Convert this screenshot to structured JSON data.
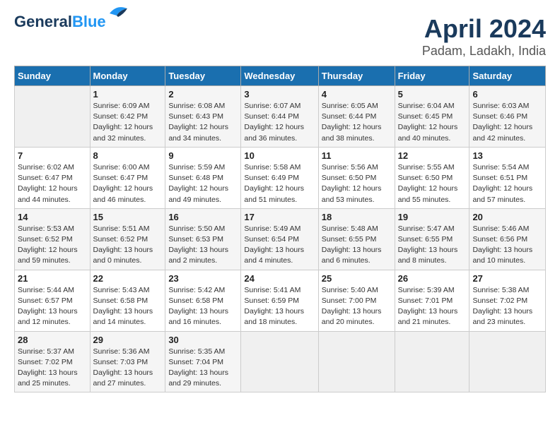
{
  "header": {
    "logo_line1": "General",
    "logo_line2": "Blue",
    "title": "April 2024",
    "subtitle": "Padam, Ladakh, India"
  },
  "weekdays": [
    "Sunday",
    "Monday",
    "Tuesday",
    "Wednesday",
    "Thursday",
    "Friday",
    "Saturday"
  ],
  "weeks": [
    [
      {
        "day": "",
        "sunrise": "",
        "sunset": "",
        "daylight": ""
      },
      {
        "day": "1",
        "sunrise": "6:09 AM",
        "sunset": "6:42 PM",
        "daylight": "12 hours and 32 minutes."
      },
      {
        "day": "2",
        "sunrise": "6:08 AM",
        "sunset": "6:43 PM",
        "daylight": "12 hours and 34 minutes."
      },
      {
        "day": "3",
        "sunrise": "6:07 AM",
        "sunset": "6:44 PM",
        "daylight": "12 hours and 36 minutes."
      },
      {
        "day": "4",
        "sunrise": "6:05 AM",
        "sunset": "6:44 PM",
        "daylight": "12 hours and 38 minutes."
      },
      {
        "day": "5",
        "sunrise": "6:04 AM",
        "sunset": "6:45 PM",
        "daylight": "12 hours and 40 minutes."
      },
      {
        "day": "6",
        "sunrise": "6:03 AM",
        "sunset": "6:46 PM",
        "daylight": "12 hours and 42 minutes."
      }
    ],
    [
      {
        "day": "7",
        "sunrise": "6:02 AM",
        "sunset": "6:47 PM",
        "daylight": "12 hours and 44 minutes."
      },
      {
        "day": "8",
        "sunrise": "6:00 AM",
        "sunset": "6:47 PM",
        "daylight": "12 hours and 46 minutes."
      },
      {
        "day": "9",
        "sunrise": "5:59 AM",
        "sunset": "6:48 PM",
        "daylight": "12 hours and 49 minutes."
      },
      {
        "day": "10",
        "sunrise": "5:58 AM",
        "sunset": "6:49 PM",
        "daylight": "12 hours and 51 minutes."
      },
      {
        "day": "11",
        "sunrise": "5:56 AM",
        "sunset": "6:50 PM",
        "daylight": "12 hours and 53 minutes."
      },
      {
        "day": "12",
        "sunrise": "5:55 AM",
        "sunset": "6:50 PM",
        "daylight": "12 hours and 55 minutes."
      },
      {
        "day": "13",
        "sunrise": "5:54 AM",
        "sunset": "6:51 PM",
        "daylight": "12 hours and 57 minutes."
      }
    ],
    [
      {
        "day": "14",
        "sunrise": "5:53 AM",
        "sunset": "6:52 PM",
        "daylight": "12 hours and 59 minutes."
      },
      {
        "day": "15",
        "sunrise": "5:51 AM",
        "sunset": "6:52 PM",
        "daylight": "13 hours and 0 minutes."
      },
      {
        "day": "16",
        "sunrise": "5:50 AM",
        "sunset": "6:53 PM",
        "daylight": "13 hours and 2 minutes."
      },
      {
        "day": "17",
        "sunrise": "5:49 AM",
        "sunset": "6:54 PM",
        "daylight": "13 hours and 4 minutes."
      },
      {
        "day": "18",
        "sunrise": "5:48 AM",
        "sunset": "6:55 PM",
        "daylight": "13 hours and 6 minutes."
      },
      {
        "day": "19",
        "sunrise": "5:47 AM",
        "sunset": "6:55 PM",
        "daylight": "13 hours and 8 minutes."
      },
      {
        "day": "20",
        "sunrise": "5:46 AM",
        "sunset": "6:56 PM",
        "daylight": "13 hours and 10 minutes."
      }
    ],
    [
      {
        "day": "21",
        "sunrise": "5:44 AM",
        "sunset": "6:57 PM",
        "daylight": "13 hours and 12 minutes."
      },
      {
        "day": "22",
        "sunrise": "5:43 AM",
        "sunset": "6:58 PM",
        "daylight": "13 hours and 14 minutes."
      },
      {
        "day": "23",
        "sunrise": "5:42 AM",
        "sunset": "6:58 PM",
        "daylight": "13 hours and 16 minutes."
      },
      {
        "day": "24",
        "sunrise": "5:41 AM",
        "sunset": "6:59 PM",
        "daylight": "13 hours and 18 minutes."
      },
      {
        "day": "25",
        "sunrise": "5:40 AM",
        "sunset": "7:00 PM",
        "daylight": "13 hours and 20 minutes."
      },
      {
        "day": "26",
        "sunrise": "5:39 AM",
        "sunset": "7:01 PM",
        "daylight": "13 hours and 21 minutes."
      },
      {
        "day": "27",
        "sunrise": "5:38 AM",
        "sunset": "7:02 PM",
        "daylight": "13 hours and 23 minutes."
      }
    ],
    [
      {
        "day": "28",
        "sunrise": "5:37 AM",
        "sunset": "7:02 PM",
        "daylight": "13 hours and 25 minutes."
      },
      {
        "day": "29",
        "sunrise": "5:36 AM",
        "sunset": "7:03 PM",
        "daylight": "13 hours and 27 minutes."
      },
      {
        "day": "30",
        "sunrise": "5:35 AM",
        "sunset": "7:04 PM",
        "daylight": "13 hours and 29 minutes."
      },
      {
        "day": "",
        "sunrise": "",
        "sunset": "",
        "daylight": ""
      },
      {
        "day": "",
        "sunrise": "",
        "sunset": "",
        "daylight": ""
      },
      {
        "day": "",
        "sunrise": "",
        "sunset": "",
        "daylight": ""
      },
      {
        "day": "",
        "sunrise": "",
        "sunset": "",
        "daylight": ""
      }
    ]
  ]
}
